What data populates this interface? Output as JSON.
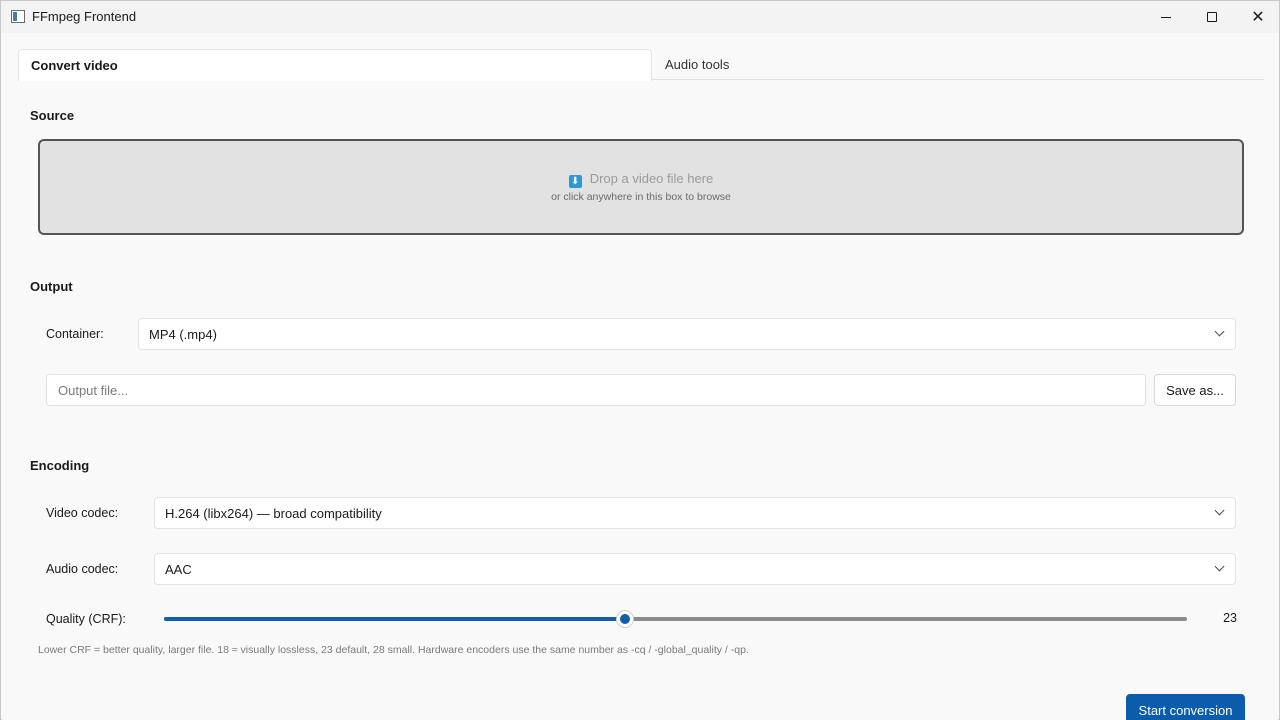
{
  "window": {
    "title": "FFmpeg Frontend"
  },
  "tabs": [
    {
      "label": "Convert video"
    },
    {
      "label": "Audio tools"
    }
  ],
  "source": {
    "section_title": "Source",
    "drop_text": "Drop a video file here",
    "drop_hint": "or click anywhere in this box to browse",
    "drop_icon": "download-icon"
  },
  "output": {
    "section_title": "Output",
    "container_label": "Container:",
    "container_value": "MP4 (.mp4)",
    "output_file_placeholder": "Output file...",
    "save_as_label": "Save as..."
  },
  "encoding": {
    "section_title": "Encoding",
    "video_codec_label": "Video codec:",
    "video_codec_value": "H.264 (libx264) — broad compatibility",
    "audio_codec_label": "Audio codec:",
    "audio_codec_value": "AAC",
    "quality_label": "Quality (CRF):",
    "quality_value": "23",
    "quality_min": 0,
    "quality_max": 51,
    "hint": "Lower CRF = better quality, larger file. 18 ≈ visually lossless, 23 default, 28 small. Hardware encoders use the same number as -cq / -global_quality / -qp."
  },
  "actions": {
    "start_label": "Start conversion"
  },
  "colors": {
    "accent": "#0b5cab",
    "drop_icon": "#2a9bd8"
  }
}
